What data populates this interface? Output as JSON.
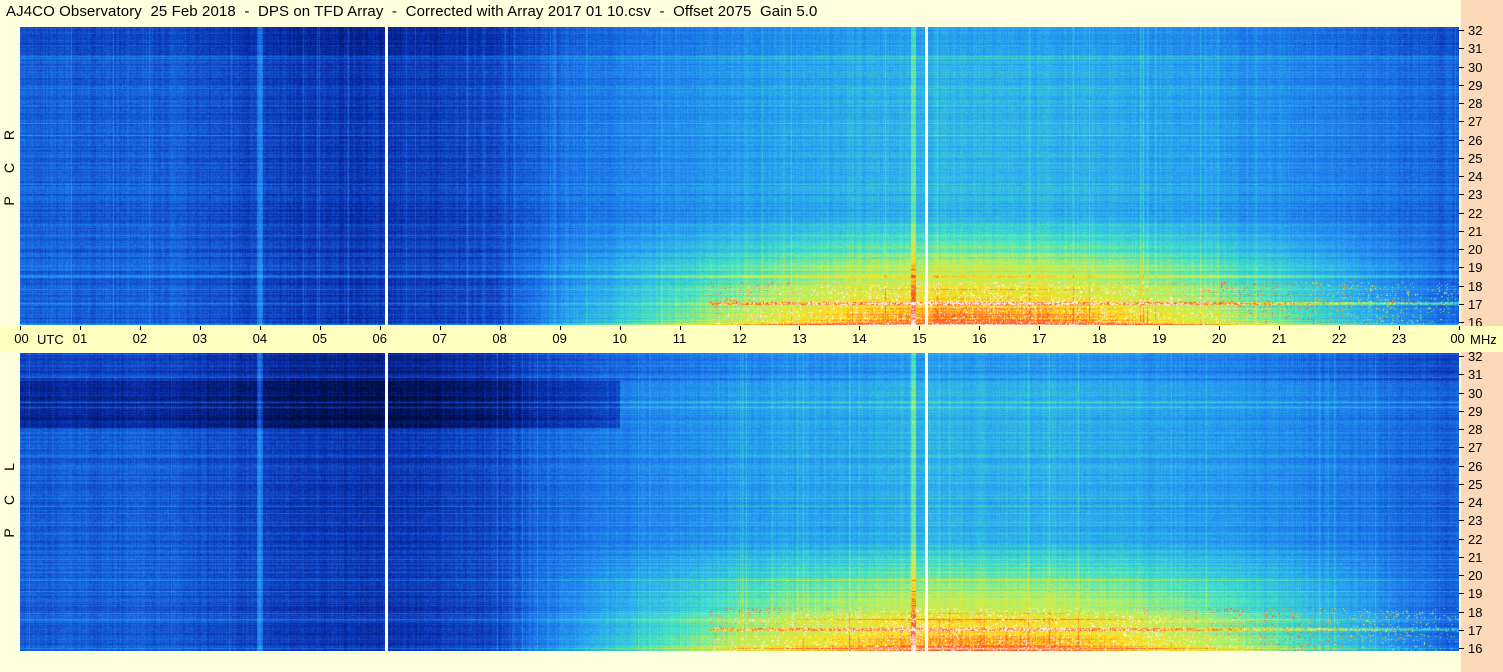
{
  "title": "AJ4CO Observatory  25 Feb 2018  -  DPS on TFD Array  -  Corrected with Array 2017 01 10.csv  -  Offset 2075  Gain 5.0",
  "chart_data": {
    "type": "heatmap",
    "title": "AJ4CO Observatory  25 Feb 2018  -  DPS on TFD Array  -  Corrected with Array 2017 01 10.csv  -  Offset 2075  Gain 5.0",
    "xlabel": "UTC",
    "ylabel": "MHz",
    "x_ticks": [
      "00",
      "01",
      "02",
      "03",
      "04",
      "05",
      "06",
      "07",
      "08",
      "09",
      "10",
      "11",
      "12",
      "13",
      "14",
      "15",
      "16",
      "17",
      "18",
      "19",
      "20",
      "21",
      "22",
      "23",
      "00"
    ],
    "xlim": [
      0,
      24
    ],
    "ylim": [
      16,
      32
    ],
    "y_ticks": [
      "16",
      "17",
      "18",
      "19",
      "20",
      "21",
      "22",
      "23",
      "24",
      "25",
      "26",
      "27",
      "28",
      "29",
      "30",
      "31",
      "32"
    ],
    "panels": [
      {
        "label": [
          "R",
          "C",
          "P"
        ],
        "name": "RCP"
      },
      {
        "label": [
          "L",
          "C",
          "P"
        ],
        "name": "LCP"
      }
    ],
    "colormap": [
      "#000a3c",
      "#0a2fb0",
      "#1a6ee8",
      "#2aa8f0",
      "#3ee0c8",
      "#b8f060",
      "#ffe020",
      "#ff4020",
      "#ffffff"
    ],
    "time_markers_utc": [
      6.08,
      15.1
    ]
  },
  "axis": {
    "utc_word": "UTC",
    "mhz_word": "MHz"
  }
}
